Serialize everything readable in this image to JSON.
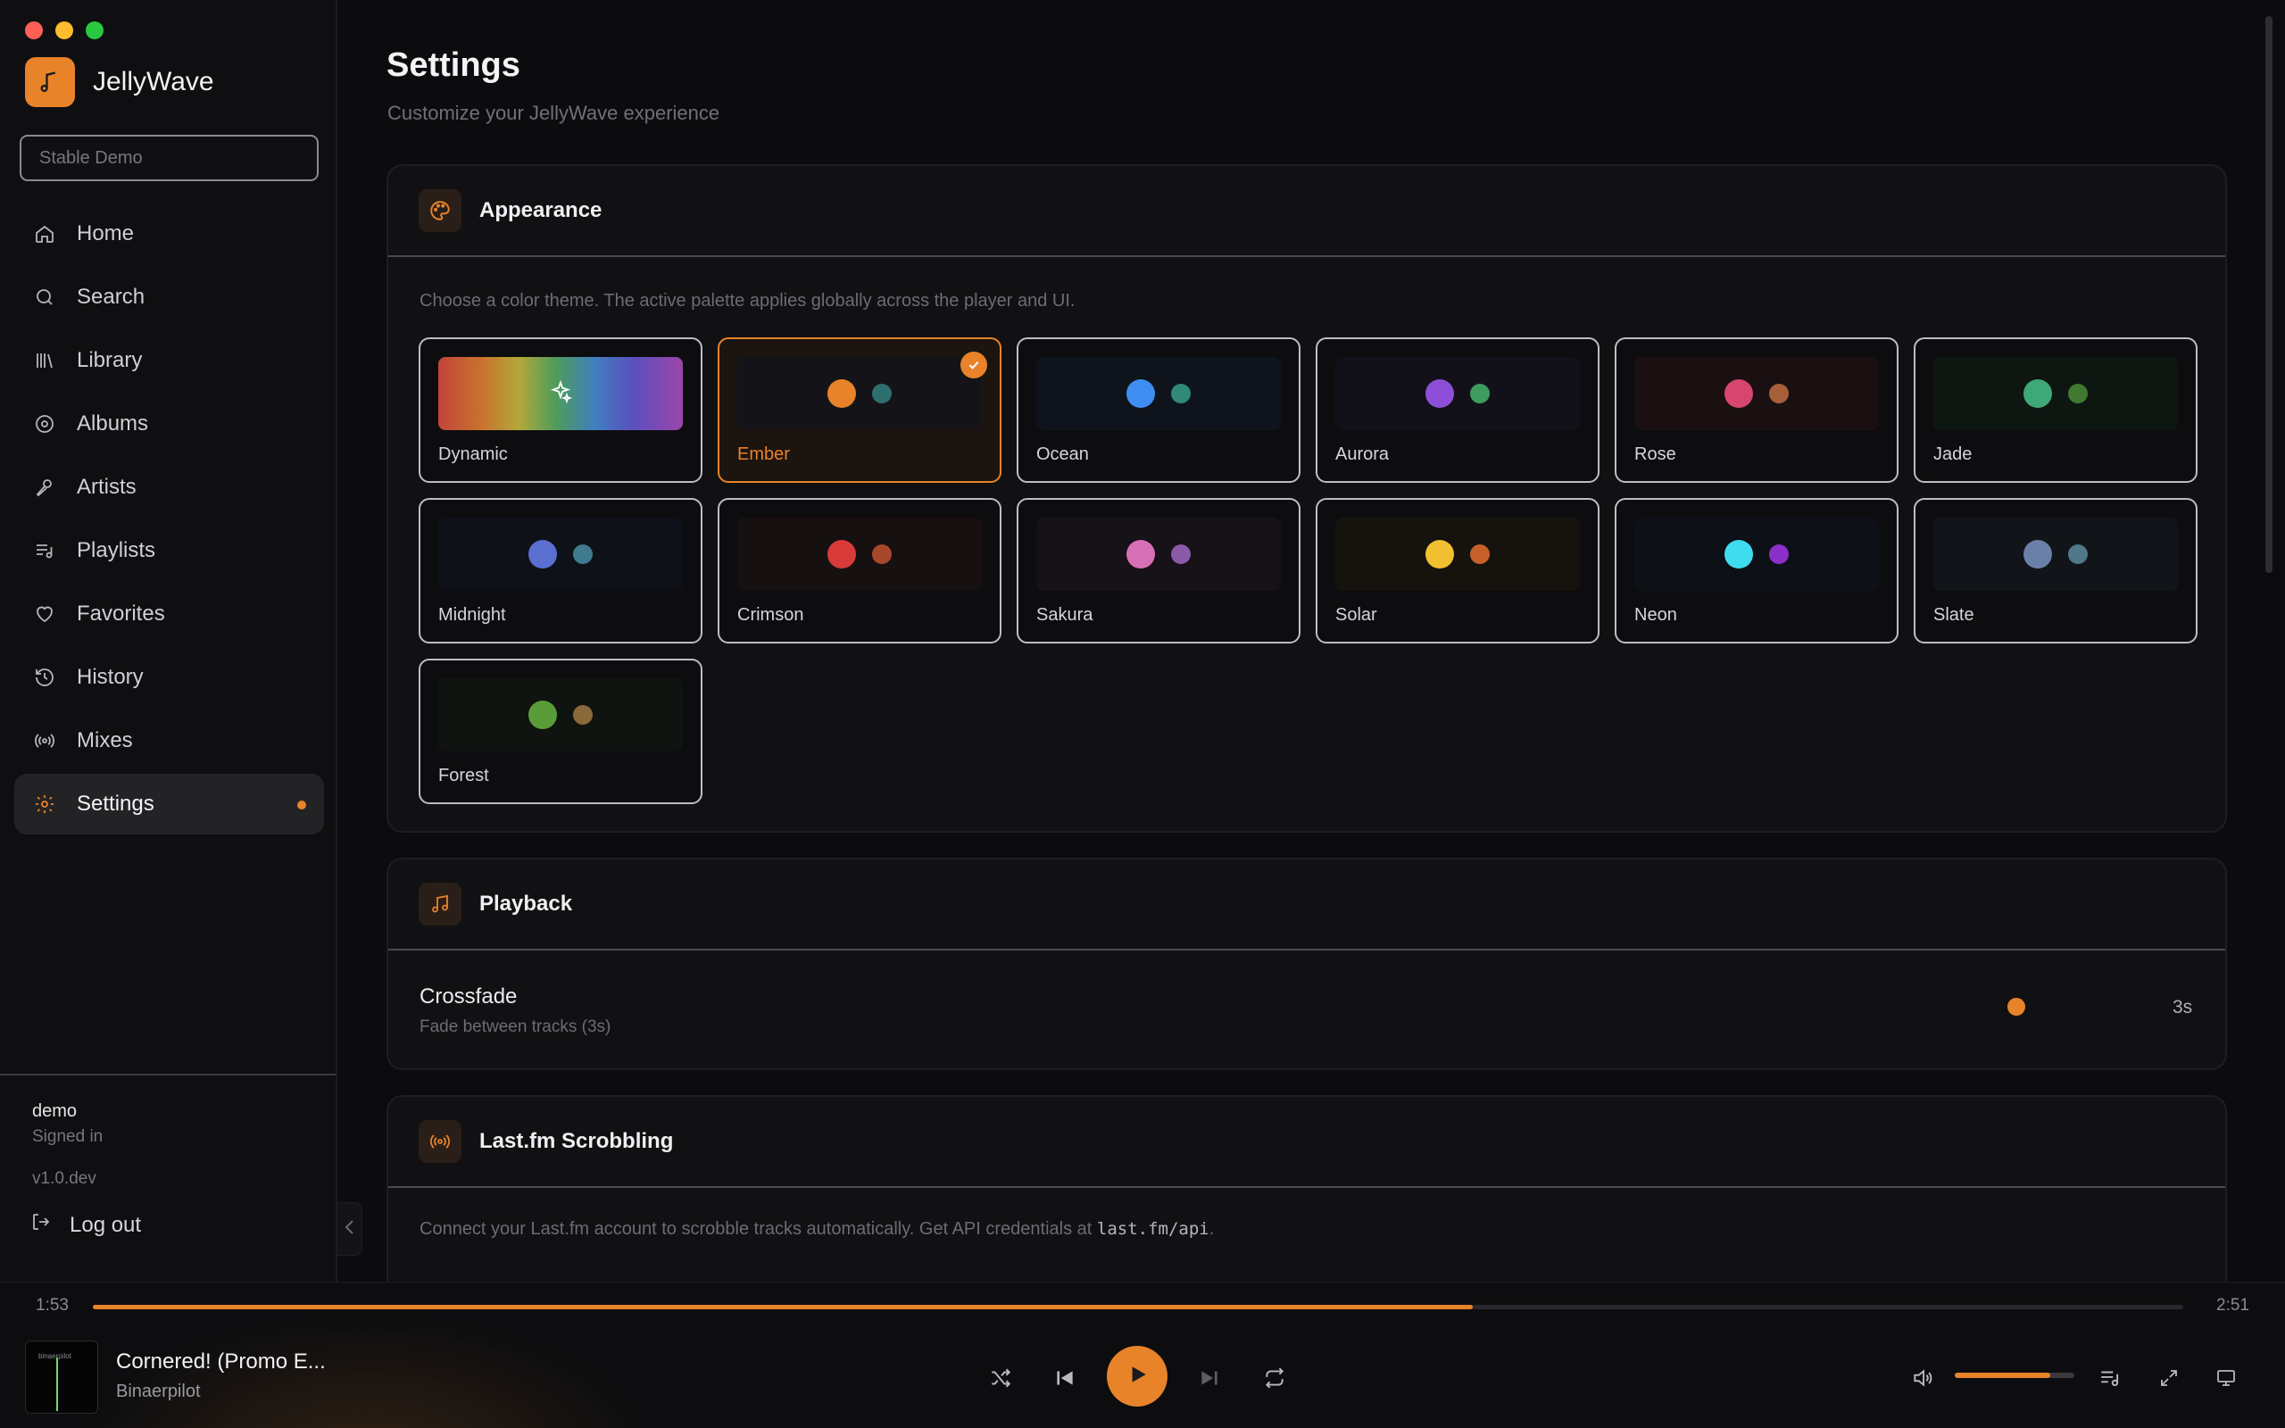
{
  "app": {
    "name": "JellyWave"
  },
  "server": {
    "value": "Stable Demo"
  },
  "nav": [
    {
      "label": "Home",
      "icon": "home-icon"
    },
    {
      "label": "Search",
      "icon": "search-icon"
    },
    {
      "label": "Library",
      "icon": "library-icon"
    },
    {
      "label": "Albums",
      "icon": "album-icon"
    },
    {
      "label": "Artists",
      "icon": "microphone-icon"
    },
    {
      "label": "Playlists",
      "icon": "playlist-icon"
    },
    {
      "label": "Favorites",
      "icon": "heart-icon"
    },
    {
      "label": "History",
      "icon": "history-icon"
    },
    {
      "label": "Mixes",
      "icon": "radio-icon"
    },
    {
      "label": "Settings",
      "icon": "gear-icon",
      "active": true
    }
  ],
  "user": {
    "name": "demo",
    "status": "Signed in",
    "version": "v1.0.dev",
    "logout_label": "Log out"
  },
  "page": {
    "title": "Settings",
    "subtitle": "Customize your JellyWave experience"
  },
  "appearance": {
    "title": "Appearance",
    "description": "Choose a color theme. The active palette applies globally across the player and UI.",
    "selected": "Ember",
    "themes": [
      {
        "name": "Dynamic",
        "dynamic": true
      },
      {
        "name": "Ember",
        "primary": "#e8832a",
        "secondary": "#2f6e6e",
        "bg": "#141418"
      },
      {
        "name": "Ocean",
        "primary": "#3d8ef0",
        "secondary": "#2f8a78",
        "bg": "#0f141c"
      },
      {
        "name": "Aurora",
        "primary": "#8e4fd8",
        "secondary": "#3f9c5f",
        "bg": "#12111a"
      },
      {
        "name": "Rose",
        "primary": "#d84670",
        "secondary": "#a8603a",
        "bg": "#1a1012"
      },
      {
        "name": "Jade",
        "primary": "#3fa878",
        "secondary": "#3f7a30",
        "bg": "#0e1612"
      },
      {
        "name": "Midnight",
        "primary": "#5a6fd0",
        "secondary": "#3f7a8e",
        "bg": "#0f1118"
      },
      {
        "name": "Crimson",
        "primary": "#d83a3a",
        "secondary": "#a8482a",
        "bg": "#171010"
      },
      {
        "name": "Sakura",
        "primary": "#d870b8",
        "secondary": "#8a5aa8",
        "bg": "#171118"
      },
      {
        "name": "Solar",
        "primary": "#f0c030",
        "secondary": "#c8602a",
        "bg": "#16130e"
      },
      {
        "name": "Neon",
        "primary": "#3fdcf0",
        "secondary": "#8a2fc8",
        "bg": "#0e1018"
      },
      {
        "name": "Slate",
        "primary": "#6a80a8",
        "secondary": "#4f7888",
        "bg": "#111418"
      },
      {
        "name": "Forest",
        "primary": "#5a9c3a",
        "secondary": "#8a6a3a",
        "bg": "#101410"
      }
    ]
  },
  "playback": {
    "title": "Playback",
    "crossfade": {
      "label": "Crossfade",
      "description": "Fade between tracks (3s)",
      "value": "3s"
    }
  },
  "lastfm": {
    "title": "Last.fm Scrobbling",
    "description": "Connect your Last.fm account to scrobble tracks automatically. Get API credentials at",
    "link": "last.fm/api",
    "suffix": "."
  },
  "player": {
    "current_time": "1:53",
    "total_time": "2:51",
    "progress": 0.66,
    "track_title": "Cornered! (Promo E...",
    "track_artist": "Binaerpilot",
    "art_text": "binaerpilot",
    "volume": 0.8
  },
  "colors": {
    "accent": "#e8832a"
  }
}
